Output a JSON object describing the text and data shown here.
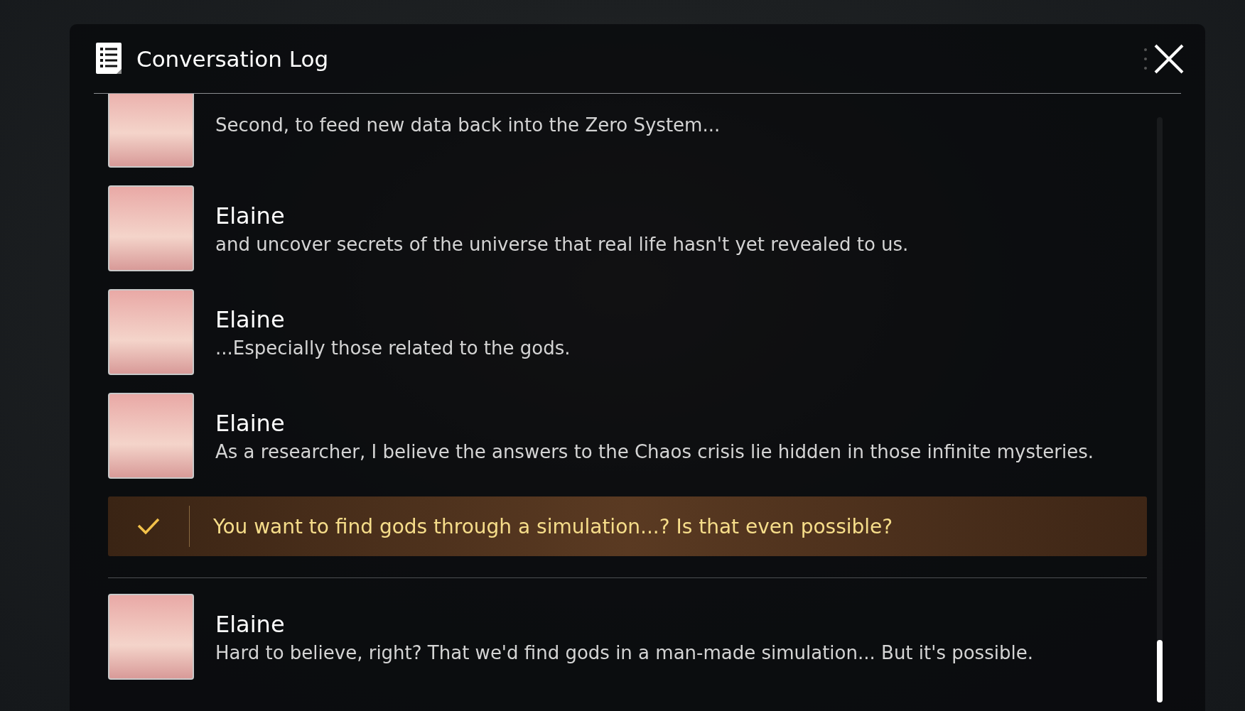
{
  "window": {
    "title": "Conversation Log"
  },
  "entries": [
    {
      "kind": "line",
      "text": "Second, to feed new data back into the Zero System..."
    },
    {
      "kind": "line",
      "name": "Elaine",
      "text": "and uncover secrets of the universe that real life hasn't yet revealed to us."
    },
    {
      "kind": "line",
      "name": "Elaine",
      "text": "...Especially those related to the gods."
    },
    {
      "kind": "line",
      "name": "Elaine",
      "text": "As a researcher, I believe the answers to the Chaos crisis lie hidden in those infinite mysteries."
    },
    {
      "kind": "choice",
      "selected": true,
      "text": "You want to find gods through a simulation...? Is that even possible?"
    },
    {
      "kind": "line",
      "name": "Elaine",
      "text": "Hard to believe, right? That we'd find gods in a man-made simulation... But it's possible."
    }
  ]
}
